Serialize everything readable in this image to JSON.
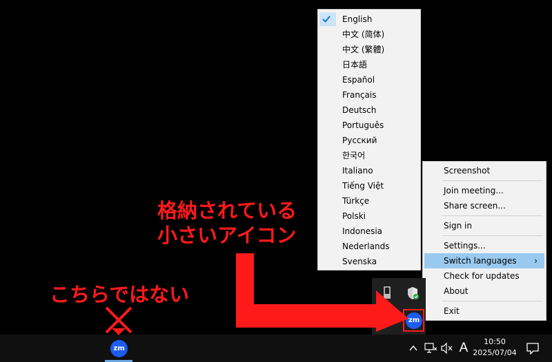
{
  "language_menu": {
    "items": [
      {
        "label": "English",
        "checked": true
      },
      {
        "label": "中文 (简体)",
        "checked": false
      },
      {
        "label": "中文 (繁體)",
        "checked": false
      },
      {
        "label": "日本語",
        "checked": false
      },
      {
        "label": "Español",
        "checked": false
      },
      {
        "label": "Français",
        "checked": false
      },
      {
        "label": "Deutsch",
        "checked": false
      },
      {
        "label": "Português",
        "checked": false
      },
      {
        "label": "Русский",
        "checked": false
      },
      {
        "label": "한국어",
        "checked": false
      },
      {
        "label": "Italiano",
        "checked": false
      },
      {
        "label": "Tiếng Việt",
        "checked": false
      },
      {
        "label": "Türkçe",
        "checked": false
      },
      {
        "label": "Polski",
        "checked": false
      },
      {
        "label": "Indonesia",
        "checked": false
      },
      {
        "label": "Nederlands",
        "checked": false
      },
      {
        "label": "Svenska",
        "checked": false
      }
    ]
  },
  "context_menu": {
    "screenshot": "Screenshot",
    "join_meeting": "Join meeting...",
    "share_screen": "Share screen...",
    "sign_in": "Sign in",
    "settings": "Settings...",
    "switch_languages": "Switch languages",
    "submenu_arrow": "›",
    "check_for_updates": "Check for updates",
    "about": "About",
    "exit": "Exit"
  },
  "annotations": {
    "stored_line1": "格納されている",
    "stored_line2": "小さいアイコン",
    "not_this": "こちらではない"
  },
  "zoom_icon_text": "zm",
  "taskbar": {
    "time": "10:50",
    "date": "2025/07/04",
    "ime_indicator": "A"
  },
  "colors": {
    "annotation_red": "#ff1a1a",
    "menu_highlight": "#99c9ef",
    "zoom_blue": "#1c5df0",
    "taskbar_bg": "#101010"
  }
}
